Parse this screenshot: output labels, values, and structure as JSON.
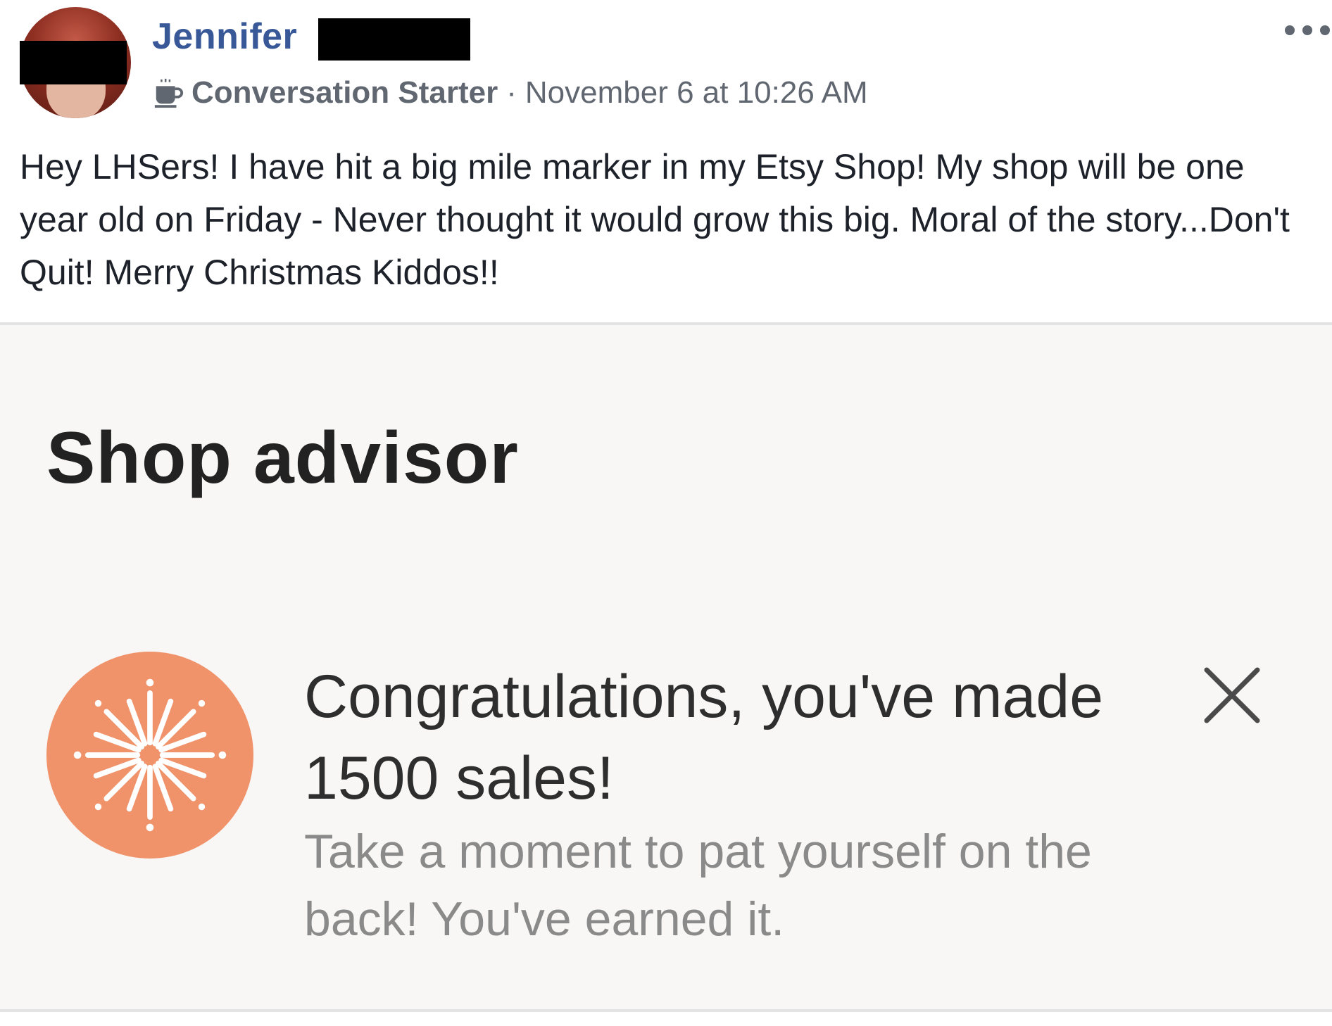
{
  "post": {
    "author_first_name": "Jennifer",
    "badge": {
      "icon": "coffee-cup-icon",
      "label": "Conversation Starter"
    },
    "separator": "·",
    "timestamp": "November 6 at 10:26 AM",
    "body": "Hey LHSers! I have hit a big mile marker in my Etsy Shop! My shop will be one year old on Friday - Never thought it would grow this big. Moral of the story...Don't Quit! Merry Christmas Kiddos!!",
    "link_color": "#385898"
  },
  "shared_image": {
    "title": "Shop advisor",
    "icon": "firework-icon",
    "icon_color": "#f0936a",
    "headline": "Congratulations, you've made 1500 sales!",
    "message": "Take a moment to pat yourself on the back! You've earned it."
  }
}
